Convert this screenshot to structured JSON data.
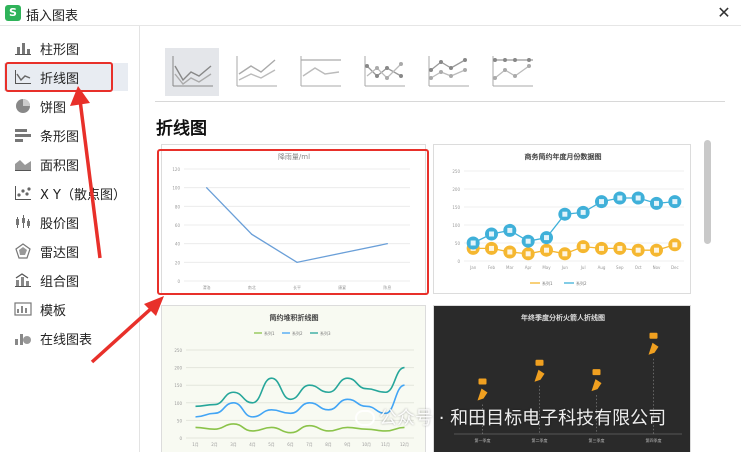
{
  "window": {
    "title": "插入图表",
    "app_icon_glyph": "S",
    "close_glyph": "✕"
  },
  "sidebar": {
    "items": [
      {
        "label": "柱形图",
        "icon": "column-chart-icon"
      },
      {
        "label": "折线图",
        "icon": "line-chart-icon",
        "active": true
      },
      {
        "label": "饼图",
        "icon": "pie-chart-icon"
      },
      {
        "label": "条形图",
        "icon": "bar-chart-icon"
      },
      {
        "label": "面积图",
        "icon": "area-chart-icon"
      },
      {
        "label": "X Y（散点图）",
        "icon": "scatter-chart-icon"
      },
      {
        "label": "股价图",
        "icon": "stock-chart-icon"
      },
      {
        "label": "雷达图",
        "icon": "radar-chart-icon"
      },
      {
        "label": "组合图",
        "icon": "combo-chart-icon"
      },
      {
        "label": "模板",
        "icon": "template-icon"
      },
      {
        "label": "在线图表",
        "icon": "online-chart-icon"
      }
    ]
  },
  "main": {
    "section_title": "折线图",
    "subtypes": [
      "line",
      "stacked-line",
      "percent-stacked-line",
      "line-markers",
      "stacked-line-markers",
      "percent-stacked-line-markers"
    ]
  },
  "thumbnails": {
    "t1": {
      "title": "降雨量/ml",
      "y_ticks": [
        "120",
        "100",
        "80",
        "60",
        "40",
        "20",
        "0"
      ],
      "categories": [
        "渭洛",
        "南北",
        "长平",
        "康宴",
        "陈息"
      ],
      "values": [
        100,
        50,
        20,
        30,
        40
      ]
    },
    "t2": {
      "title": "商务简约年度月份数据图",
      "y_ticks": [
        "250",
        "200",
        "150",
        "100",
        "50",
        "0"
      ],
      "categories": [
        "Jan",
        "Feb",
        "Mar",
        "Apr",
        "May",
        "Jun",
        "Jul",
        "Aug",
        "Sep",
        "Oct",
        "Nov",
        "Dec"
      ],
      "series": [
        {
          "name": "系列1",
          "values": [
            35,
            35,
            25,
            20,
            30,
            20,
            40,
            35,
            35,
            30,
            30,
            45
          ],
          "color": "#f5b730"
        },
        {
          "name": "系列2",
          "values": [
            50,
            75,
            85,
            55,
            65,
            130,
            135,
            165,
            175,
            175,
            160,
            165
          ],
          "color": "#3fb0d9"
        }
      ]
    },
    "t3": {
      "title": "简约堆积折线图",
      "legend": [
        "系列1",
        "系列2",
        "系列3"
      ],
      "y_ticks": [
        "250",
        "200",
        "150",
        "100",
        "50",
        "0"
      ],
      "categories": [
        "1月",
        "2月",
        "3月",
        "4月",
        "5月",
        "6月",
        "7月",
        "8月",
        "9月",
        "10月",
        "11月",
        "12月"
      ],
      "series": [
        {
          "name": "系列1",
          "values": [
            30,
            25,
            40,
            20,
            30,
            15,
            35,
            20,
            30,
            25,
            20,
            30
          ],
          "color": "#8bc34a"
        },
        {
          "name": "系列2",
          "values": [
            60,
            70,
            100,
            60,
            80,
            70,
            100,
            80,
            110,
            90,
            70,
            150
          ],
          "color": "#42a5f5"
        },
        {
          "name": "系列3",
          "values": [
            90,
            95,
            130,
            100,
            170,
            110,
            150,
            130,
            170,
            140,
            130,
            200
          ],
          "color": "#26a69a"
        }
      ]
    },
    "t4": {
      "title": "年终季度分析火箭人折线图",
      "categories": [
        "第一季度",
        "第二季度",
        "第三季度",
        "第四季度"
      ],
      "values": [
        38,
        56,
        47,
        82
      ],
      "ymax": 100
    }
  },
  "colors": {
    "accent_red": "#e8302a",
    "selected_bg": "#e8ecf2",
    "brand_green": "#2fb35a"
  },
  "watermark": "公众号 · 和田目标电子科技有限公司"
}
